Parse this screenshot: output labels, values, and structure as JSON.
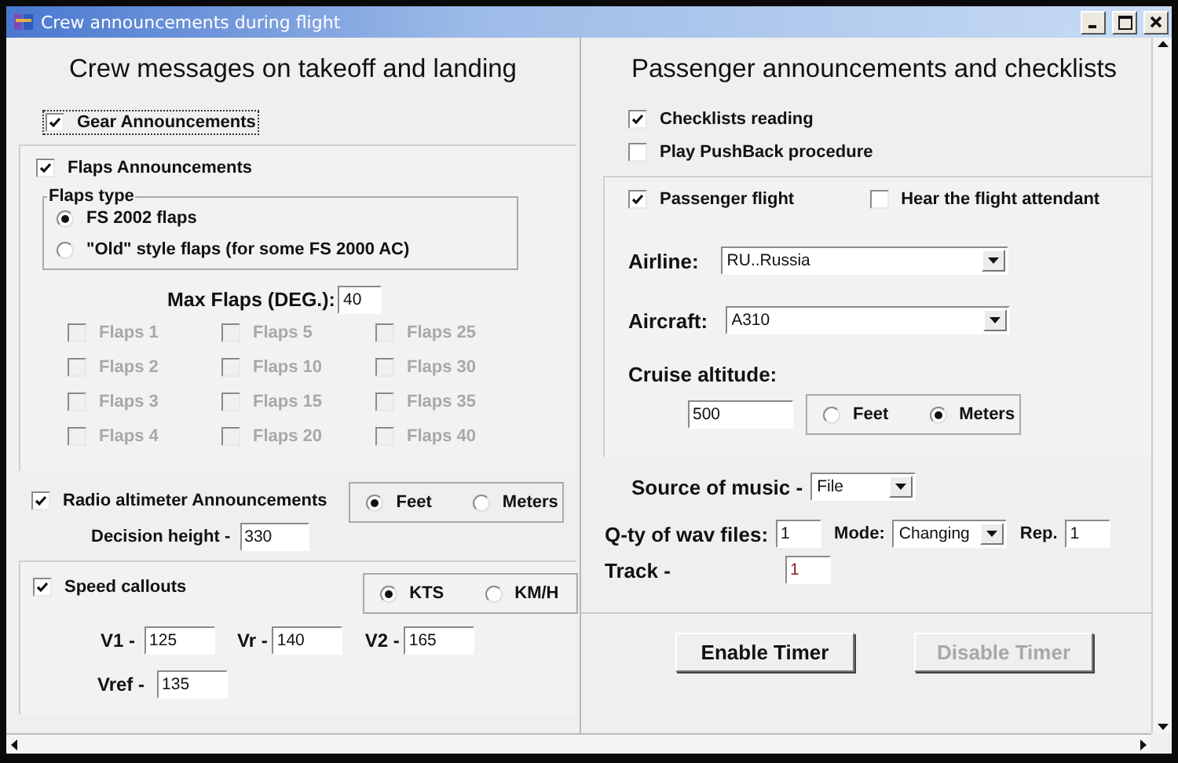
{
  "window": {
    "title": "Crew announcements during flight"
  },
  "crew": {
    "heading": "Crew messages on takeoff and landing",
    "gear": {
      "label": "Gear Announcements",
      "checked": true
    },
    "flaps": {
      "label": "Flaps Announcements",
      "checked": true,
      "type_group": {
        "title": "Flaps type",
        "options": [
          {
            "label": "FS 2002 flaps",
            "selected": true
          },
          {
            "label": "\"Old\" style flaps (for some FS 2000 AC)",
            "selected": false
          }
        ]
      },
      "max_flaps": {
        "label": "Max Flaps (DEG.):",
        "value": "40"
      },
      "positions": [
        {
          "label": "Flaps 1",
          "checked": false,
          "disabled": true
        },
        {
          "label": "Flaps 5",
          "checked": false,
          "disabled": true
        },
        {
          "label": "Flaps 25",
          "checked": false,
          "disabled": true
        },
        {
          "label": "Flaps 2",
          "checked": false,
          "disabled": true
        },
        {
          "label": "Flaps 10",
          "checked": false,
          "disabled": true
        },
        {
          "label": "Flaps 30",
          "checked": false,
          "disabled": true
        },
        {
          "label": "Flaps 3",
          "checked": false,
          "disabled": true
        },
        {
          "label": "Flaps 15",
          "checked": false,
          "disabled": true
        },
        {
          "label": "Flaps 35",
          "checked": false,
          "disabled": true
        },
        {
          "label": "Flaps 4",
          "checked": false,
          "disabled": true
        },
        {
          "label": "Flaps 20",
          "checked": false,
          "disabled": true
        },
        {
          "label": "Flaps 40",
          "checked": false,
          "disabled": true
        }
      ]
    },
    "radio_altimeter": {
      "label": "Radio altimeter Announcements",
      "checked": true,
      "units": [
        {
          "label": "Feet",
          "selected": true
        },
        {
          "label": "Meters",
          "selected": false
        }
      ],
      "decision_height": {
        "label": "Decision height -",
        "value": "330"
      }
    },
    "speed": {
      "label": "Speed callouts",
      "checked": true,
      "units": [
        {
          "label": "KTS",
          "selected": true
        },
        {
          "label": "KM/H",
          "selected": false
        }
      ],
      "fields": [
        {
          "label": "V1 -",
          "value": "125"
        },
        {
          "label": "Vr -",
          "value": "140"
        },
        {
          "label": "V2 -",
          "value": "165"
        },
        {
          "label": "Vref -",
          "value": "135"
        }
      ]
    }
  },
  "passenger": {
    "heading": "Passenger announcements and checklists",
    "options": [
      {
        "label": "Checklists reading",
        "checked": true
      },
      {
        "label": "Play PushBack procedure",
        "checked": false
      }
    ],
    "flight_options": [
      {
        "label": "Passenger flight",
        "checked": true
      },
      {
        "label": "Hear the flight attendant",
        "checked": false
      }
    ],
    "airline": {
      "label": "Airline:",
      "value": "RU..Russia"
    },
    "aircraft": {
      "label": "Aircraft:",
      "value": "A310"
    },
    "cruise_altitude": {
      "label": "Cruise altitude:",
      "value": "500",
      "units": [
        {
          "label": "Feet",
          "selected": false
        },
        {
          "label": "Meters",
          "selected": true
        }
      ]
    },
    "music_source": {
      "label": "Source of music -",
      "value": "File"
    },
    "wav_count": {
      "label": "Q-ty of wav files:",
      "value": "1"
    },
    "mode": {
      "label": "Mode:",
      "value": "Changing"
    },
    "repeat": {
      "label": "Rep.",
      "value": "1"
    },
    "track": {
      "label": "Track -",
      "value": "1"
    },
    "buttons": [
      {
        "label": "Enable Timer",
        "disabled": false
      },
      {
        "label": "Disable Timer",
        "disabled": true
      }
    ]
  }
}
